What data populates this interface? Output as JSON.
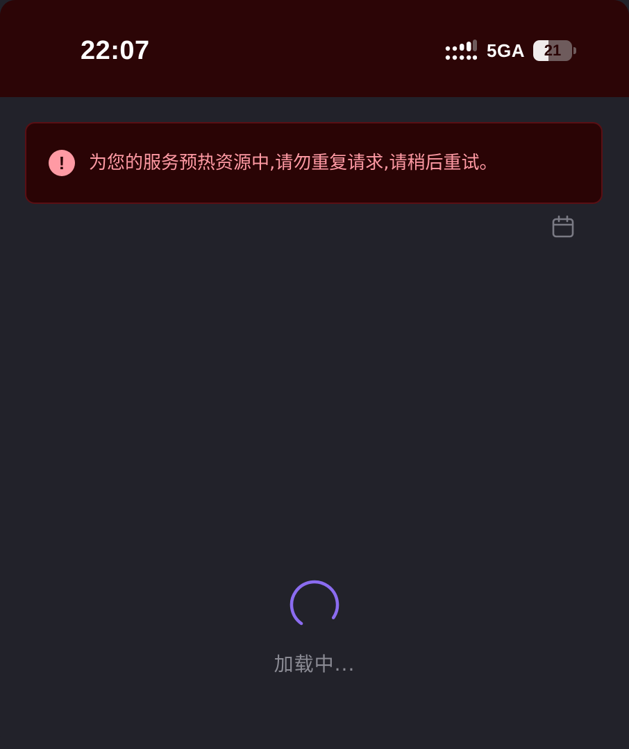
{
  "status_bar": {
    "time": "22:07",
    "network": "5GA",
    "battery_level": "21",
    "battery_fraction": 0.4,
    "signal_icon": "signal-strength-icon",
    "background_color": "#2c0506"
  },
  "alert": {
    "icon": "alert-exclamation-icon",
    "icon_glyph": "!",
    "message": "为您的服务预热资源中,请勿重复请求,请稍后重试。",
    "text_color": "#ff9aa4",
    "background_color": "#2a0405"
  },
  "toolbar": {
    "calendar_icon": "calendar-icon"
  },
  "loading": {
    "text": "加载中...",
    "spinner_color": "#8b6cf0"
  },
  "theme": {
    "page_background": "#22222a"
  }
}
